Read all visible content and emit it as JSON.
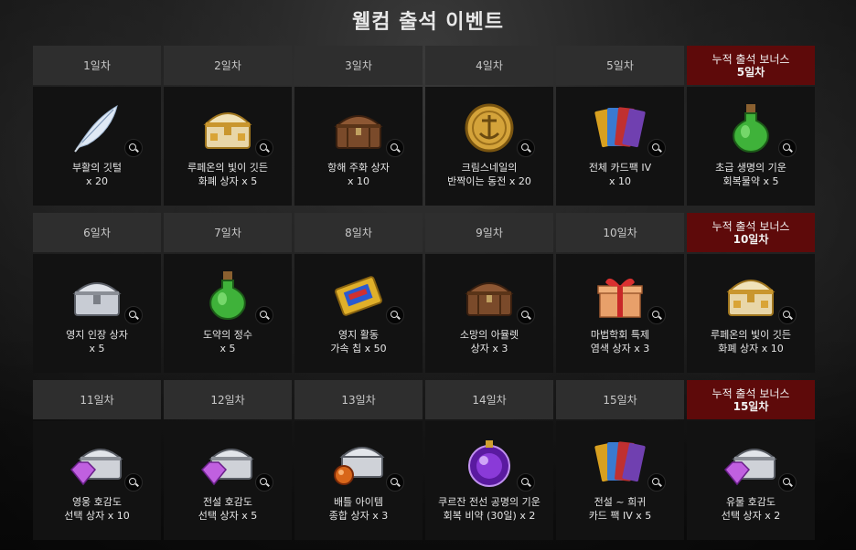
{
  "page": {
    "title": "웰컴 출석 이벤트"
  },
  "rows": [
    [
      {
        "day": "1일차",
        "line1": "부활의 깃털",
        "line2": "x 20",
        "icon": "feather-icon"
      },
      {
        "day": "2일차",
        "line1": "루페온의 빛이 깃든",
        "line2": "화폐 상자 x 5",
        "icon": "gold-chest-icon"
      },
      {
        "day": "3일차",
        "line1": "항해 주화 상자",
        "line2": "x 10",
        "icon": "wooden-chest-icon"
      },
      {
        "day": "4일차",
        "line1": "크림스네일의",
        "line2": "반짝이는 동전 x 20",
        "icon": "gold-coin-icon"
      },
      {
        "day": "5일차",
        "line1": "전체 카드팩 IV",
        "line2": "x 10",
        "icon": "card-pack-icon"
      },
      {
        "bonus": true,
        "bonus_label": "누적 출석 보너스",
        "day": "5일차",
        "line1": "초급 생명의 기운",
        "line2": "회복물약 x 5",
        "icon": "green-potion-icon"
      }
    ],
    [
      {
        "day": "6일차",
        "line1": "영지 인장 상자",
        "line2": "x 5",
        "icon": "silver-chest-icon"
      },
      {
        "day": "7일차",
        "line1": "도약의 정수",
        "line2": "x 5",
        "icon": "green-potion-icon"
      },
      {
        "day": "8일차",
        "line1": "영지 활동",
        "line2": "가속 칩 x 50",
        "icon": "gold-ticket-icon"
      },
      {
        "day": "9일차",
        "line1": "소망의 아뮬렛",
        "line2": "상자 x 3",
        "icon": "wooden-chest-icon"
      },
      {
        "day": "10일차",
        "line1": "마법학회 특제",
        "line2": "염색 상자 x 3",
        "icon": "gift-box-icon"
      },
      {
        "bonus": true,
        "bonus_label": "누적 출석 보너스",
        "day": "10일차",
        "line1": "루페온의 빛이 깃든",
        "line2": "화폐 상자 x 10",
        "icon": "gold-chest-icon"
      }
    ],
    [
      {
        "day": "11일차",
        "line1": "영웅 호감도",
        "line2": "선택 상자 x 10",
        "icon": "gem-chest-icon"
      },
      {
        "day": "12일차",
        "line1": "전설 호감도",
        "line2": "선택 상자 x 5",
        "icon": "gem-chest-icon"
      },
      {
        "day": "13일차",
        "line1": "배틀 아이템",
        "line2": "종합 상자 x 3",
        "icon": "battle-chest-icon"
      },
      {
        "day": "14일차",
        "line1": "쿠르잔 전선 공명의 기운",
        "line2": "회복 비약 (30일) x 2",
        "icon": "purple-orb-icon"
      },
      {
        "day": "15일차",
        "line1": "전설 ~ 희귀",
        "line2": "카드 팩 IV x 5",
        "icon": "card-pack-icon"
      },
      {
        "bonus": true,
        "bonus_label": "누적 출석 보너스",
        "day": "15일차",
        "line1": "유물 호감도",
        "line2": "선택 상자 x 2",
        "icon": "gem-chest-icon"
      }
    ]
  ]
}
